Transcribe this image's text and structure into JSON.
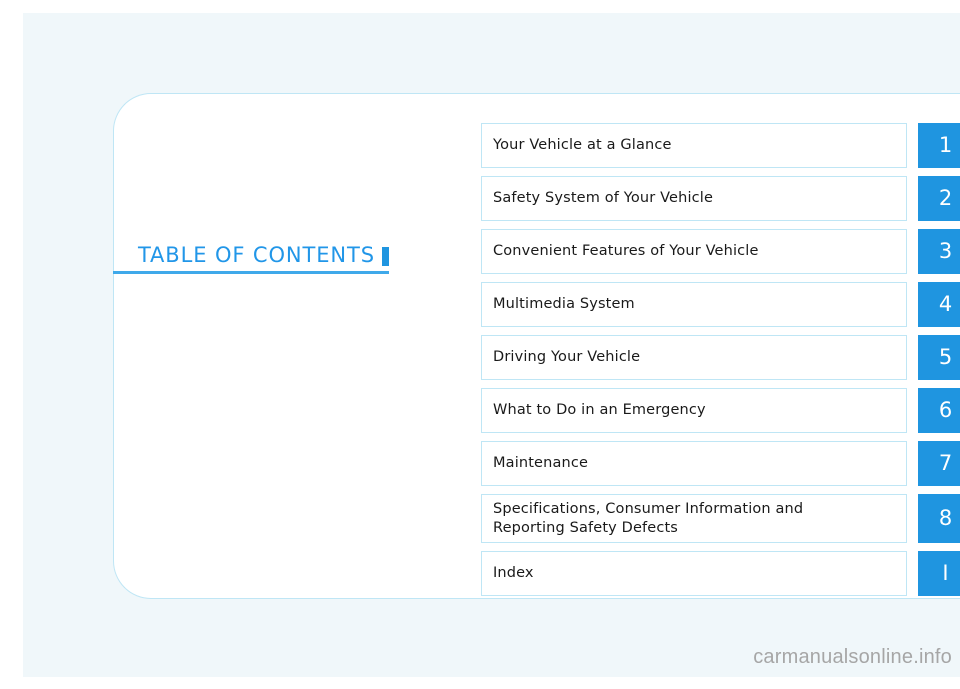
{
  "page": {
    "background_color": "#f0f7fa",
    "card_background": "#ffffff",
    "accent_color": "#1f95e0",
    "border_color": "#bfe6f5"
  },
  "title": {
    "text": "TABLE OF CONTENTS"
  },
  "contents": {
    "items": [
      {
        "label_line1": "Your Vehicle at a Glance",
        "label_line2": "",
        "number": "1"
      },
      {
        "label_line1": "Safety System of Your Vehicle",
        "label_line2": "",
        "number": "2"
      },
      {
        "label_line1": "Convenient Features of Your Vehicle",
        "label_line2": "",
        "number": "3"
      },
      {
        "label_line1": "Multimedia System",
        "label_line2": "",
        "number": "4"
      },
      {
        "label_line1": "Driving Your Vehicle",
        "label_line2": "",
        "number": "5"
      },
      {
        "label_line1": "What to Do in an Emergency",
        "label_line2": "",
        "number": "6"
      },
      {
        "label_line1": "Maintenance",
        "label_line2": "",
        "number": "7"
      },
      {
        "label_line1": "Specifications, Consumer Information and",
        "label_line2": "Reporting Safety Defects",
        "number": "8"
      },
      {
        "label_line1": "Index",
        "label_line2": "",
        "number": "I"
      }
    ]
  },
  "watermark": {
    "text": "carmanualsonline.info"
  }
}
